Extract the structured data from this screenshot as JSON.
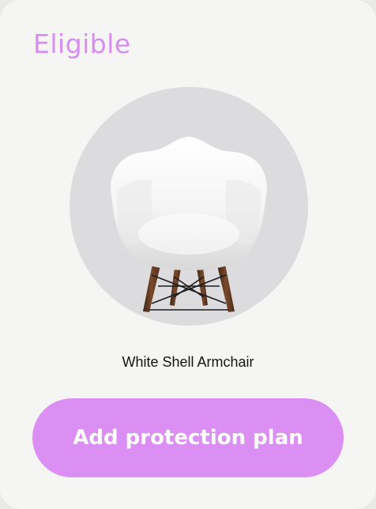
{
  "card": {
    "status_label": "Eligible",
    "product_name": "White Shell Armchair",
    "product_image_icon": "armchair-icon",
    "cta_label": "Add protection plan"
  },
  "colors": {
    "accent": "#dc8ff2",
    "status_text": "#d88df1",
    "card_background": "#f5f5f3",
    "image_background": "#dcdcde",
    "text": "#141414"
  }
}
